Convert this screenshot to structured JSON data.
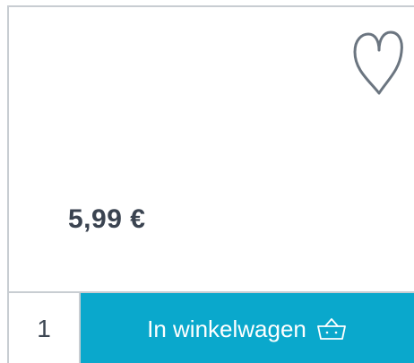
{
  "product": {
    "price": "5,99 €"
  },
  "wishlist": {
    "icon": "heart-icon"
  },
  "cart": {
    "quantity": "1",
    "add_label": "In winkelwagen",
    "icon": "basket-icon"
  },
  "colors": {
    "accent": "#0aa8cc",
    "border": "#c8cdd2",
    "text": "#3c4652"
  }
}
